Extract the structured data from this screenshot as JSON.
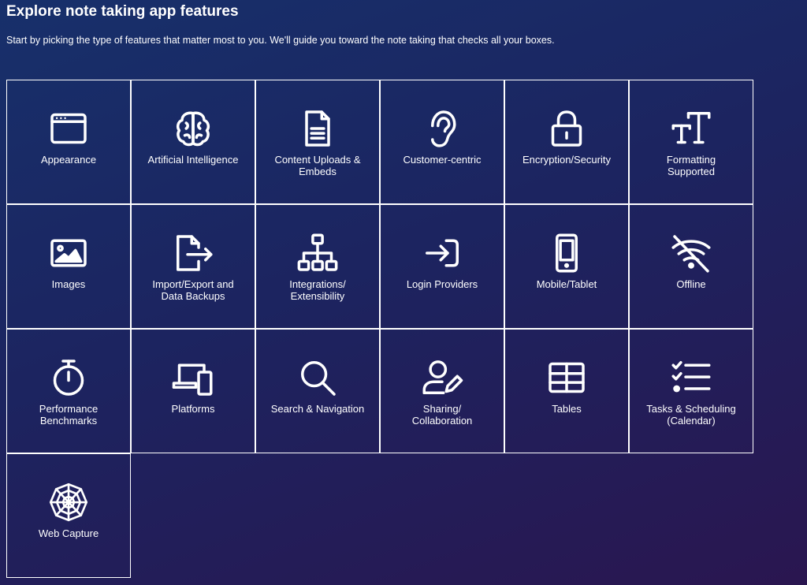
{
  "header": {
    "title": "Explore note taking app features",
    "subtitle": "Start by picking the type of features that matter most to you. We'll guide you toward the note taking that checks all your boxes."
  },
  "features": [
    {
      "label": "Appearance",
      "icon": "browser-window-icon"
    },
    {
      "label": "Artificial Intelligence",
      "icon": "brain-icon"
    },
    {
      "label": "Content Uploads &\nEmbeds",
      "icon": "document-icon"
    },
    {
      "label": "Customer-centric",
      "icon": "ear-icon"
    },
    {
      "label": "Encryption/Security",
      "icon": "lock-icon"
    },
    {
      "label": "Formatting\nSupported",
      "icon": "text-size-icon"
    },
    {
      "label": "Images",
      "icon": "image-icon"
    },
    {
      "label": "Import/Export and\nData Backups",
      "icon": "file-export-icon"
    },
    {
      "label": "Integrations/\nExtensibility",
      "icon": "sitemap-icon"
    },
    {
      "label": "Login Providers",
      "icon": "sign-in-icon"
    },
    {
      "label": "Mobile/Tablet",
      "icon": "mobile-icon"
    },
    {
      "label": "Offline",
      "icon": "wifi-off-icon"
    },
    {
      "label": "Performance\nBenchmarks",
      "icon": "stopwatch-icon"
    },
    {
      "label": "Platforms",
      "icon": "devices-icon"
    },
    {
      "label": "Search & Navigation",
      "icon": "search-icon"
    },
    {
      "label": "Sharing/\nCollaboration",
      "icon": "user-edit-icon"
    },
    {
      "label": "Tables",
      "icon": "table-icon"
    },
    {
      "label": "Tasks & Scheduling\n(Calendar)",
      "icon": "task-list-icon"
    },
    {
      "label": "Web Capture",
      "icon": "spider-web-icon"
    }
  ]
}
